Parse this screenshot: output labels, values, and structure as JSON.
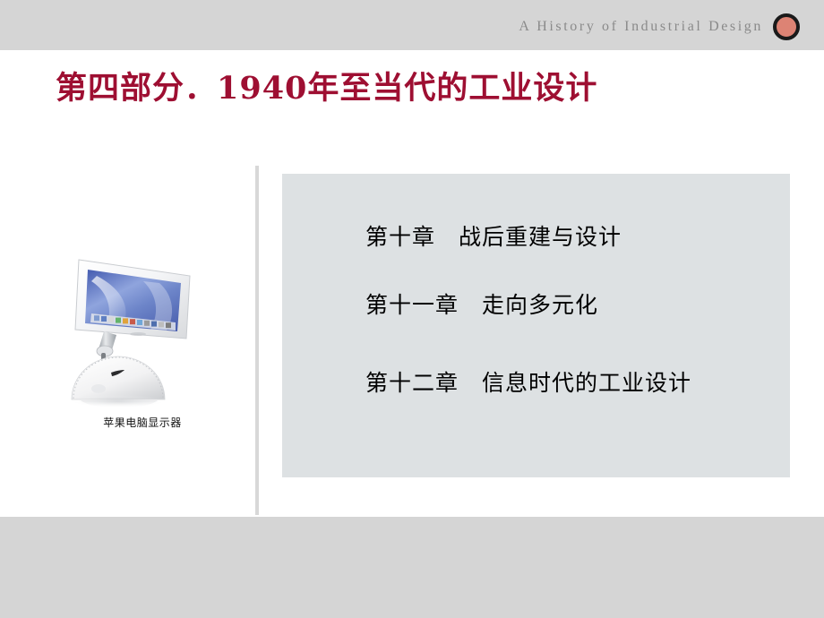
{
  "header": {
    "title": "A  History  of  Industrial  Design",
    "dot_fill": "#dd8374",
    "dot_stroke": "#1a1a1a",
    "band_color": "#d5d5d5"
  },
  "title": {
    "text": "第四部分．1940年至当代的工业设计",
    "color": "#9e0f32"
  },
  "figure": {
    "caption": "苹果电脑显示器",
    "alt": "Apple iMac G4 flat panel display on dome base"
  },
  "panel": {
    "background": "#dde1e3",
    "chapters": [
      {
        "label": "第十章　战后重建与设计"
      },
      {
        "label": "第十一章　走向多元化"
      },
      {
        "label": "第十二章　信息时代的工业设计"
      }
    ]
  },
  "footer": {
    "band_color": "#d5d5d5"
  }
}
